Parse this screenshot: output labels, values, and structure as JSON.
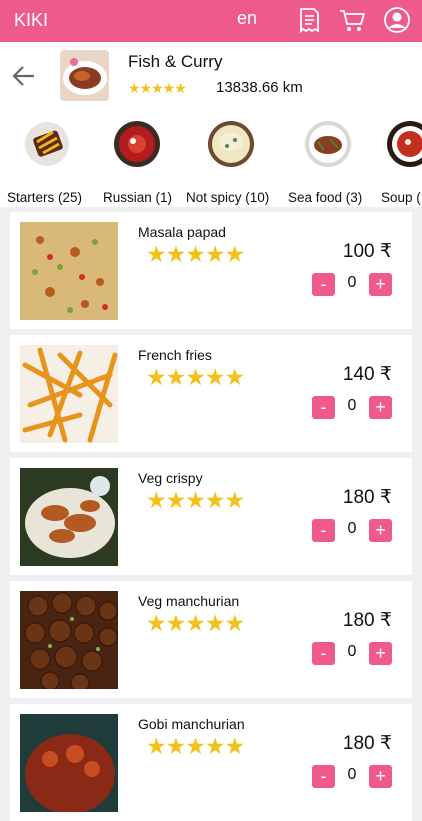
{
  "header": {
    "brand": "KIKI",
    "language": "en",
    "icons": [
      "receipt-icon",
      "cart-icon",
      "user-icon"
    ],
    "color": "#ee5b8a"
  },
  "restaurant": {
    "name": "Fish & Curry",
    "stars": "★★★★★",
    "distance": "13838.66 km"
  },
  "categories": [
    {
      "label": "Starters (25)"
    },
    {
      "label": "Russian (1)"
    },
    {
      "label": "Not spicy (10)"
    },
    {
      "label": "Sea food (3)"
    },
    {
      "label": "Soup ("
    }
  ],
  "dishes": [
    {
      "name": "Masala papad",
      "stars": "★★★★★",
      "price": "100 ₹",
      "qty": "0"
    },
    {
      "name": "French fries",
      "stars": "★★★★★",
      "price": "140 ₹",
      "qty": "0"
    },
    {
      "name": "Veg crispy",
      "stars": "★★★★★",
      "price": "180 ₹",
      "qty": "0"
    },
    {
      "name": "Veg manchurian",
      "stars": "★★★★★",
      "price": "180 ₹",
      "qty": "0"
    },
    {
      "name": "Gobi manchurian",
      "stars": "★★★★★",
      "price": "180 ₹",
      "qty": "0"
    }
  ],
  "controls": {
    "minus": "-",
    "plus": "+"
  },
  "colors": {
    "accent": "#ee5b8a",
    "star": "#f2c21b"
  }
}
